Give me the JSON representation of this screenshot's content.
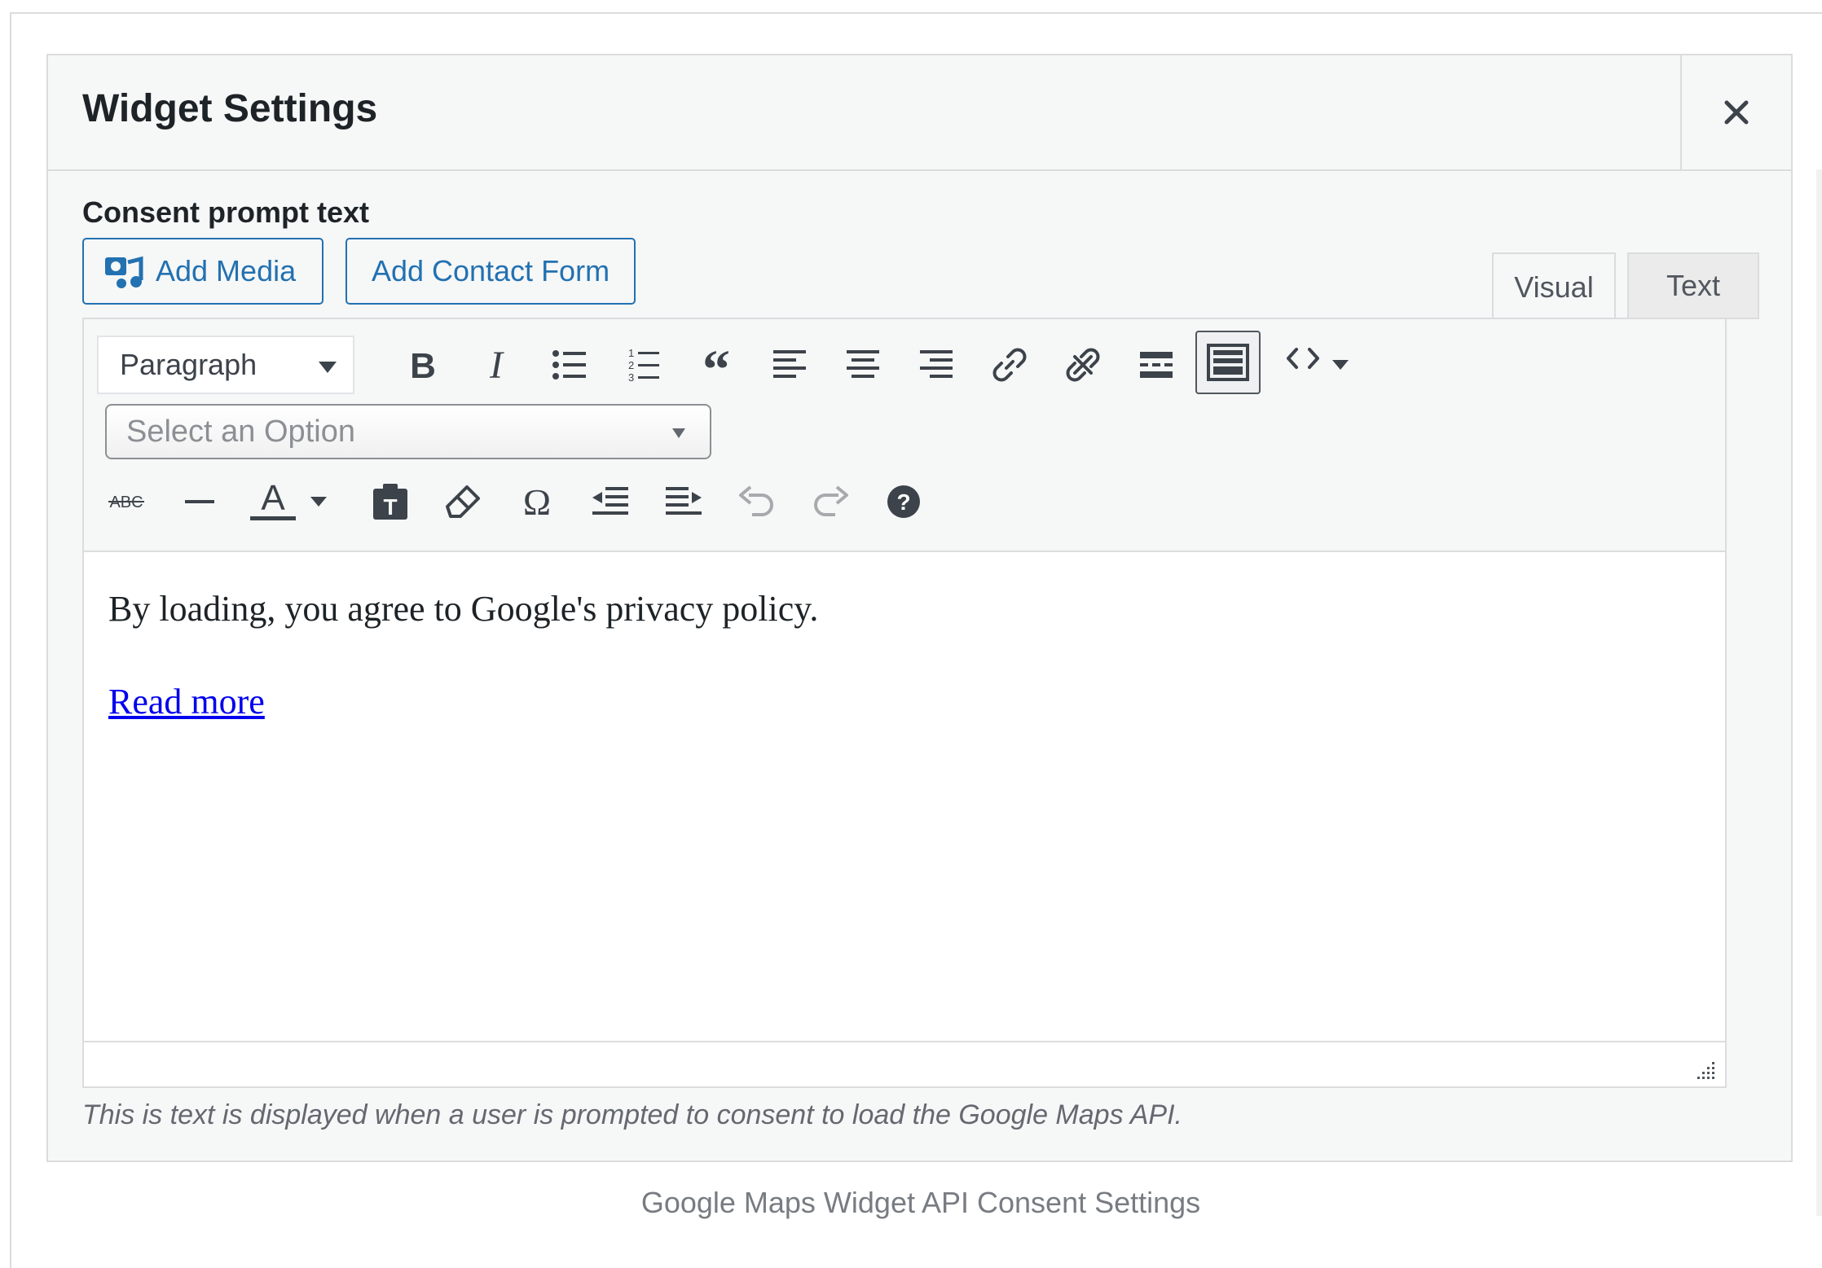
{
  "panel": {
    "title": "Widget Settings",
    "close_icon": "close-icon"
  },
  "field": {
    "label": "Consent prompt text",
    "help": "This is text is displayed when a user is prompted to consent to load the Google Maps API."
  },
  "media_buttons": {
    "add_media": "Add Media",
    "add_contact_form": "Add Contact Form"
  },
  "tabs": {
    "visual": "Visual",
    "text": "Text",
    "active": "Visual"
  },
  "toolbar": {
    "format_select": "Paragraph",
    "option_select_placeholder": "Select an Option",
    "row1_icons": [
      "bold-icon",
      "italic-icon",
      "bullet-list-icon",
      "numbered-list-icon",
      "blockquote-icon",
      "align-left-icon",
      "align-center-icon",
      "align-right-icon",
      "link-icon",
      "unlink-icon",
      "read-more-icon",
      "toolbar-toggle-icon",
      "code-icon",
      "dropdown-caret-icon"
    ],
    "row2_icons": [
      "strikethrough-icon",
      "horizontal-line-icon",
      "text-color-icon",
      "text-color-caret-icon",
      "paste-text-icon",
      "clear-formatting-icon",
      "special-character-icon",
      "outdent-icon",
      "indent-icon",
      "undo-icon",
      "redo-icon",
      "help-icon"
    ],
    "strikethrough_glyph": "ABC",
    "text_color_glyph": "A"
  },
  "content": {
    "paragraph": "By loading, you agree to Google's privacy policy.",
    "link_text": "Read more"
  },
  "caption": "Google Maps Widget API Consent Settings",
  "colors": {
    "accent": "#2271b1",
    "link": "#0000ee",
    "panel_bg": "#f6f7f7",
    "border": "#dcdcde"
  }
}
